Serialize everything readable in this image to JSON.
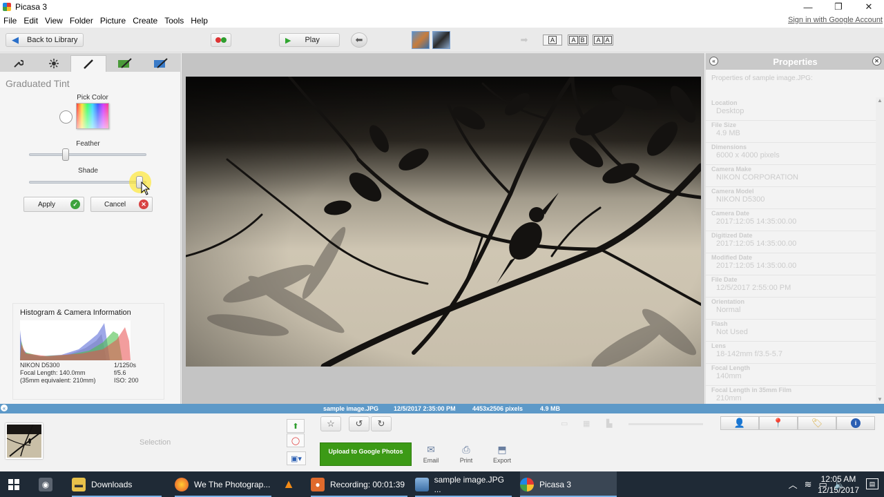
{
  "window": {
    "title": "Picasa 3",
    "controls": {
      "minimize": "—",
      "restore": "❐",
      "close": "✕"
    }
  },
  "menu": {
    "items": [
      "File",
      "Edit",
      "View",
      "Folder",
      "Picture",
      "Create",
      "Tools",
      "Help"
    ],
    "signin": "Sign in with Google Account"
  },
  "toolbar": {
    "back_label": "Back to Library",
    "play_label": "Play",
    "text_buttons": [
      [
        "A"
      ],
      [
        "A",
        "B"
      ],
      [
        "A",
        "A"
      ]
    ]
  },
  "edit_panel": {
    "tabs": [
      "wrench-icon",
      "sun-icon",
      "brush-icon",
      "effects-brush-icon",
      "effects-brush-alt-icon"
    ],
    "active_tab": 2,
    "effect_title": "Graduated Tint",
    "pick_color_label": "Pick Color",
    "feather_label": "Feather",
    "feather_value": 0.3,
    "shade_label": "Shade",
    "shade_value": 0.97,
    "apply_label": "Apply",
    "cancel_label": "Cancel"
  },
  "histogram": {
    "title": "Histogram & Camera Information",
    "camera": "NIKON D5300",
    "focal_length": "Focal Length: 140.0mm",
    "equivalent": "(35mm equivalent: 210mm)",
    "shutter": "1/1250s",
    "aperture": "f/5.6",
    "iso": "ISO: 200"
  },
  "properties": {
    "title": "Properties",
    "subtitle": "Properties of sample image.JPG:",
    "rows": [
      {
        "name": "Location",
        "value": "Desktop"
      },
      {
        "name": "File Size",
        "value": "4.9 MB"
      },
      {
        "name": "Dimensions",
        "value": "6000 x 4000 pixels"
      },
      {
        "name": "Camera Make",
        "value": "NIKON CORPORATION"
      },
      {
        "name": "Camera Model",
        "value": "NIKON D5300"
      },
      {
        "name": "Camera Date",
        "value": "2017:12:05 14:35:00.00"
      },
      {
        "name": "Digitized Date",
        "value": "2017:12:05 14:35:00.00"
      },
      {
        "name": "Modified Date",
        "value": "2017:12:05 14:35:00.00"
      },
      {
        "name": "File Date",
        "value": "12/5/2017 2:55:00 PM"
      },
      {
        "name": "Orientation",
        "value": "Normal"
      },
      {
        "name": "Flash",
        "value": "Not Used"
      },
      {
        "name": "Lens",
        "value": "18-142mm f/3.5-5.7"
      },
      {
        "name": "Focal Length",
        "value": "140mm"
      },
      {
        "name": "Focal Length in 35mm Film",
        "value": "210mm"
      }
    ]
  },
  "status": {
    "filename": "sample image.JPG",
    "date": "12/5/2017 2:35:00 PM",
    "dimensions": "4453x2506 pixels",
    "size": "4.9 MB"
  },
  "tray": {
    "selection_label": "Selection",
    "upload_label": "Upload to Google Photos",
    "email_label": "Email",
    "print_label": "Print",
    "export_label": "Export"
  },
  "taskbar": {
    "items": [
      {
        "label": "Downloads"
      },
      {
        "label": "We The Photograp..."
      },
      {
        "label": "Recording:  00:01:39"
      },
      {
        "label": "sample image.JPG ..."
      },
      {
        "label": "Picasa 3"
      }
    ],
    "time": "12:05 AM",
    "date": "12/15/2017"
  }
}
